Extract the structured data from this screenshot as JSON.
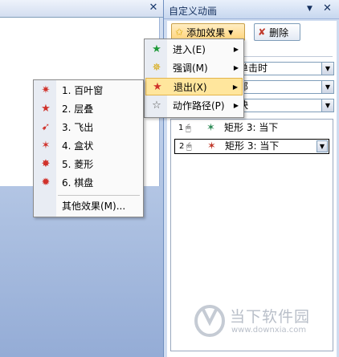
{
  "doc": {
    "close_glyph": "✕"
  },
  "pane": {
    "title": "自定义动画",
    "caret_glyph": "▼",
    "close_glyph": "✕",
    "add_effect_label": "添加效果",
    "delete_label": "删除",
    "rows": [
      {
        "value": "单击时"
      },
      {
        "value": "部"
      },
      {
        "value": "快"
      }
    ],
    "items": [
      {
        "num": "1",
        "text": "矩形 3: 当下"
      },
      {
        "num": "2",
        "text": "矩形 3: 当下"
      }
    ]
  },
  "main_menu": {
    "items": [
      {
        "label": "进入(E)",
        "icon": "enter-star-icon"
      },
      {
        "label": "强调(M)",
        "icon": "emphasis-star-icon"
      },
      {
        "label": "退出(X)",
        "icon": "exit-star-icon"
      },
      {
        "label": "动作路径(P)",
        "icon": "motion-path-star-icon"
      }
    ]
  },
  "exit_menu": {
    "items": [
      {
        "num": "1.",
        "label": "百叶窗"
      },
      {
        "num": "2.",
        "label": "层叠"
      },
      {
        "num": "3.",
        "label": "飞出"
      },
      {
        "num": "4.",
        "label": "盒状"
      },
      {
        "num": "5.",
        "label": "菱形"
      },
      {
        "num": "6.",
        "label": "棋盘"
      }
    ],
    "more_label": "其他效果(M)..."
  },
  "watermark": {
    "text": "当下软件园",
    "url": "www.downxia.com"
  },
  "colors": {
    "highlight": "#ffe69d",
    "pane_bg": "#cfdcf0",
    "doc_blue": "#94acd6"
  }
}
